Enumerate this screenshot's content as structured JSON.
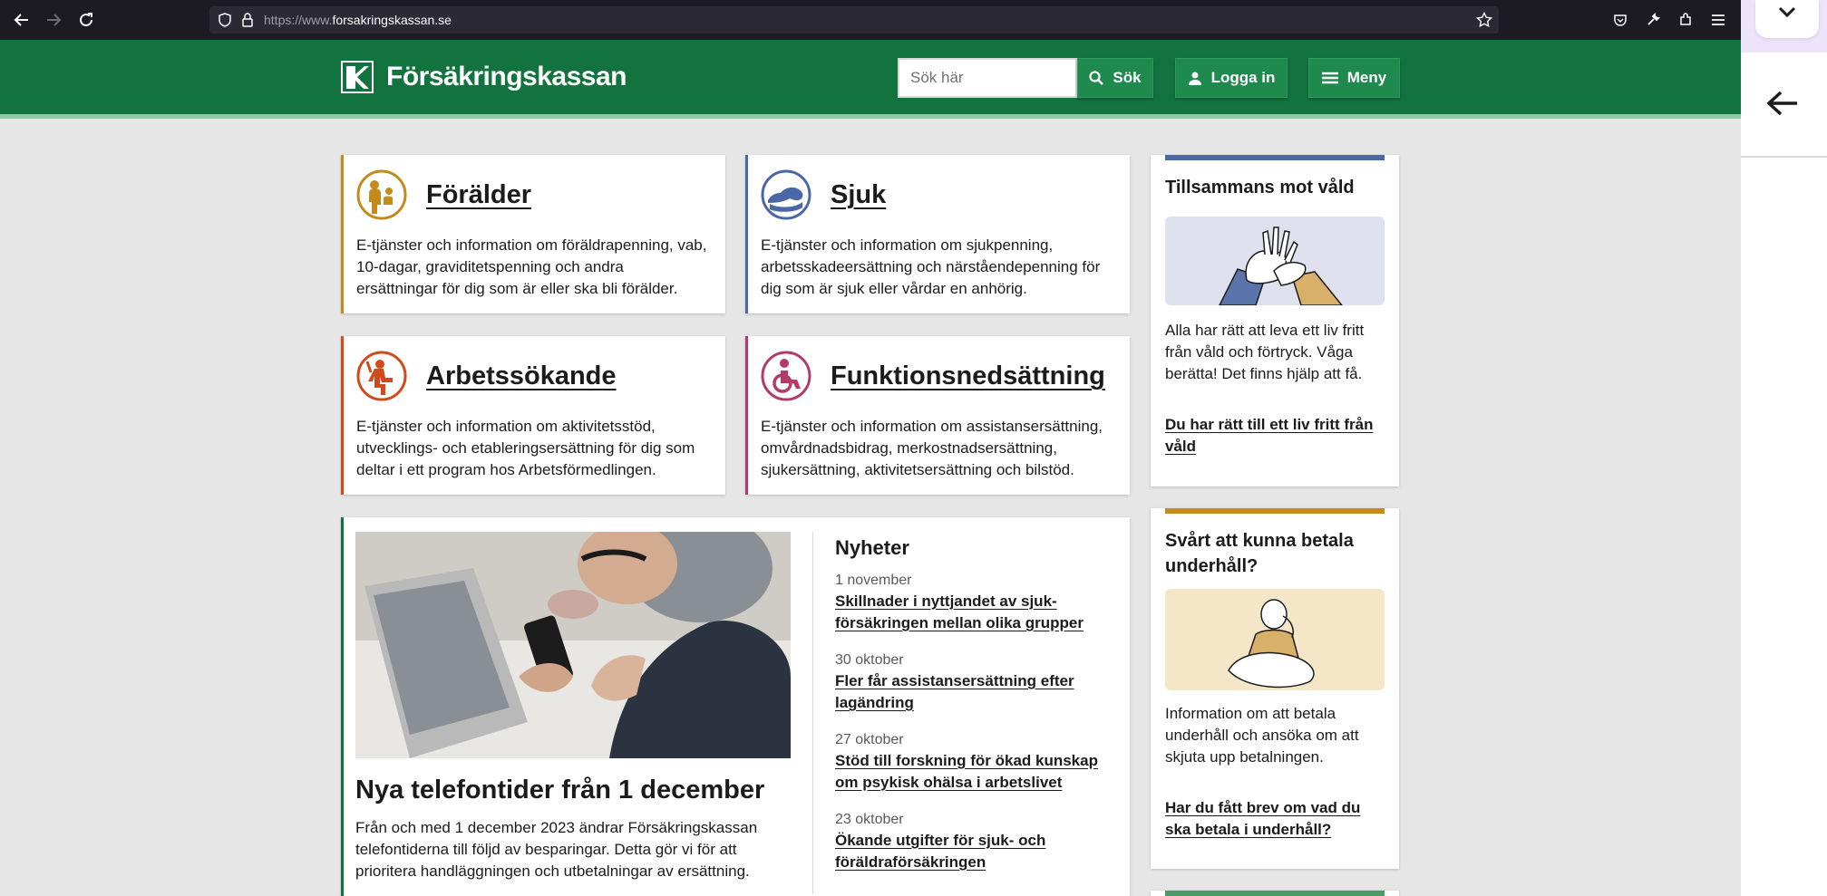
{
  "browser": {
    "url_prefix": "https://www.",
    "url_domain": "forsakringskassan.se"
  },
  "header": {
    "logo_text": "Försäkringskassan",
    "search_placeholder": "Sök här",
    "search_button": "Sök",
    "login_button": "Logga in",
    "menu_button": "Meny"
  },
  "cards": [
    {
      "title": "Förälder",
      "text": "E-tjänster och information om föräldrapenning, vab, 10-dagar, graviditetspenning och andra ersättningar för dig som är eller ska bli förälder.",
      "color": "#c48a1a"
    },
    {
      "title": "Sjuk",
      "text": "E-tjänster och information om sjukpenning, arbetsskadeersättning och närståendepenning för dig som är sjuk eller vårdar en anhörig.",
      "color": "#4a68a8"
    },
    {
      "title": "Arbetssökande",
      "text": "E-tjänster och information om aktivitetsstöd, utvecklings- och etableringsersättning för dig som deltar i ett program hos Arbetsförmedlingen.",
      "color": "#d24a1a"
    },
    {
      "title": "Funktionsnedsättning",
      "text": "E-tjänster och information om assistansersättning, omvårdnadsbidrag, merkostnadsersättning, sjukersättning, aktivitetsersättning och bilstöd.",
      "color": "#b33a6a"
    }
  ],
  "side_cards": [
    {
      "title": "Tillsammans mot våld",
      "text": "Alla har rätt att leva ett liv fritt från våld och förtryck. Våga berätta! Det finns hjälp att få.",
      "link": "Du har rätt till ett liv fritt från våld",
      "color": "#4a68a8"
    },
    {
      "title": "Svårt att kunna betala underhåll?",
      "text": "Information om att betala underhåll och ansöka om att skjuta upp betalningen.",
      "link": "Har du fått brev om vad du ska betala i underhåll?",
      "color": "#c48a1a"
    }
  ],
  "feature": {
    "title": "Nya telefontider från 1 december",
    "text": "Från och med 1 december 2023 ändrar Försäkringskassan telefontiderna till följd av besparingar. Detta gör vi för att prioritera handläggningen och utbetalningar av ersättning."
  },
  "news": {
    "heading": "Nyheter",
    "items": [
      {
        "date": "1 november",
        "title": "Skillnader i nyttjandet av sjuk-försäkringen mellan olika grupper"
      },
      {
        "date": "30 oktober",
        "title": "Fler får assistansersättning efter lagändring"
      },
      {
        "date": "27 oktober",
        "title": "Stöd till forskning för ökad kunskap om psykisk ohälsa i arbetslivet"
      },
      {
        "date": "23 oktober",
        "title": "Ökande utgifter för sjuk- och föräldraförsäkringen"
      }
    ]
  },
  "colors": {
    "brand_green": "#12733f",
    "page_bg": "#e6e6e6"
  }
}
